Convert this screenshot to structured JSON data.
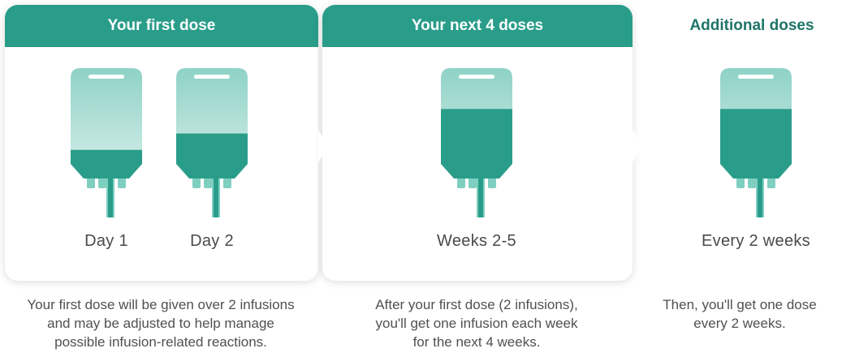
{
  "columns": [
    {
      "header": "Your first dose",
      "bags": [
        {
          "label": "Day 1",
          "fill": 0.28
        },
        {
          "label": "Day 2",
          "fill": 0.44
        }
      ],
      "description": [
        "Your first dose will be given over 2 infusions",
        "and may be adjusted to help manage",
        "possible infusion-related reactions."
      ]
    },
    {
      "header": "Your next 4 doses",
      "bags": [
        {
          "label": "Weeks 2-5",
          "fill": 0.68
        }
      ],
      "description": [
        "After your first dose (2 infusions),",
        "you'll get one infusion each week",
        "for the next 4 weeks."
      ]
    },
    {
      "header": "Additional doses",
      "bags": [
        {
          "label": "Every 2 weeks",
          "fill": 0.68
        }
      ],
      "description": [
        "Then, you'll get one dose",
        "every 2 weeks."
      ]
    }
  ],
  "colors": {
    "header_bg": "#2a9d8a",
    "header_text_plain": "#1f7568",
    "bag_light": "#a6dbd2",
    "bag_fluid": "#2a9d8a",
    "bag_outline": "#7fcfc1"
  }
}
